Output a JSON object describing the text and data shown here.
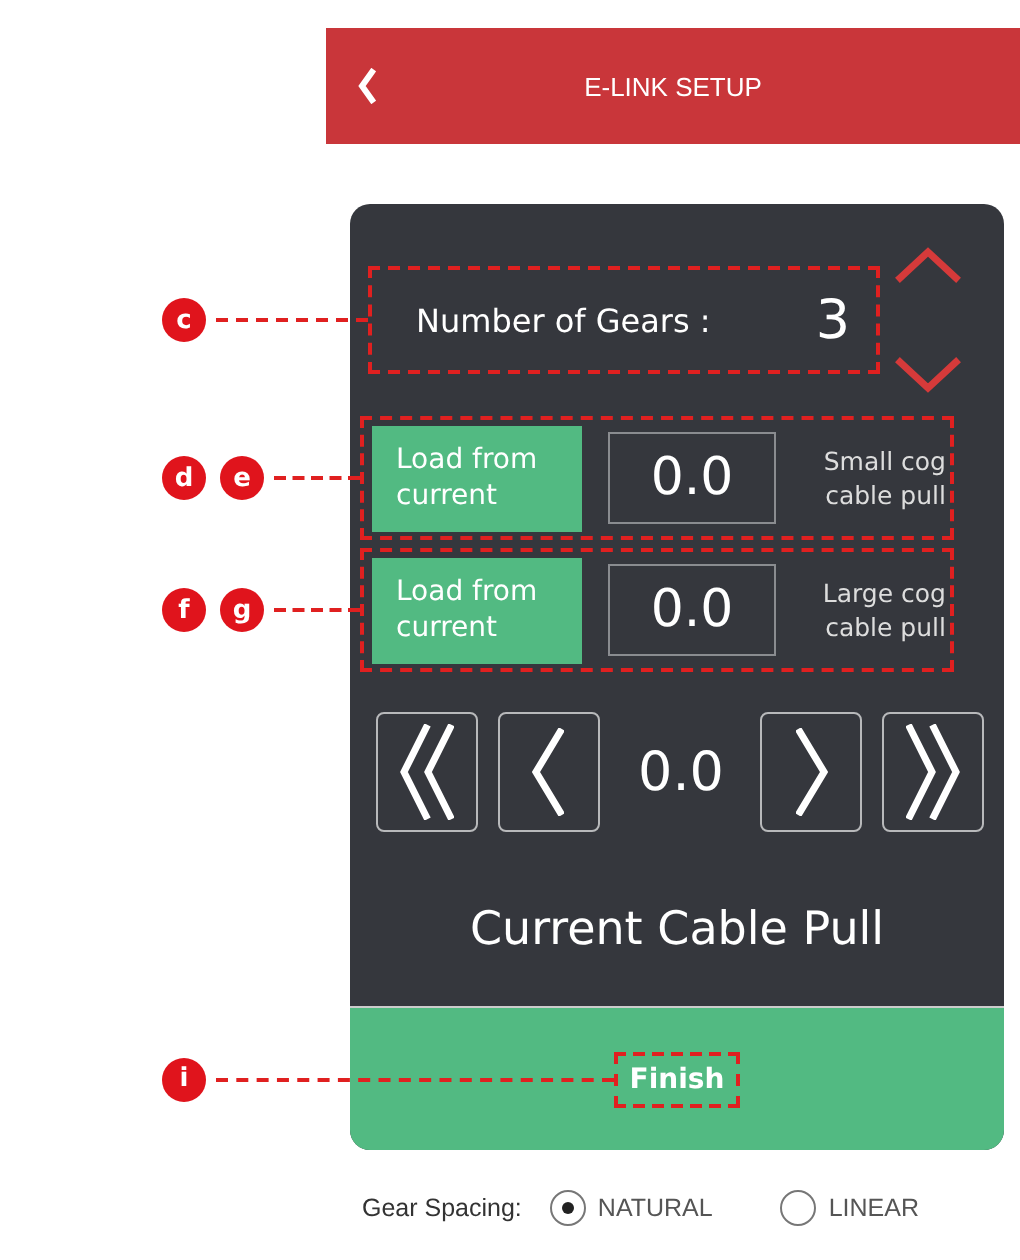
{
  "header": {
    "title": "E-LINK SETUP"
  },
  "gears": {
    "label": "Number of Gears :",
    "value": "3",
    "markers": [
      "c"
    ]
  },
  "cable_rows": [
    {
      "button": "Load from current",
      "value": "0.0",
      "label": "Small cog cable pull",
      "markers": [
        "d",
        "e"
      ]
    },
    {
      "button": "Load from current",
      "value": "0.0",
      "label": "Large cog cable pull",
      "markers": [
        "f",
        "g"
      ]
    }
  ],
  "adjuster": {
    "value": "0.0",
    "title": "Current Cable Pull"
  },
  "finish": {
    "label": "Finish",
    "markers": [
      "i"
    ]
  },
  "gear_spacing": {
    "label": "Gear Spacing:",
    "options": [
      {
        "label": "NATURAL",
        "selected": true
      },
      {
        "label": "LINEAR",
        "selected": false
      }
    ]
  }
}
